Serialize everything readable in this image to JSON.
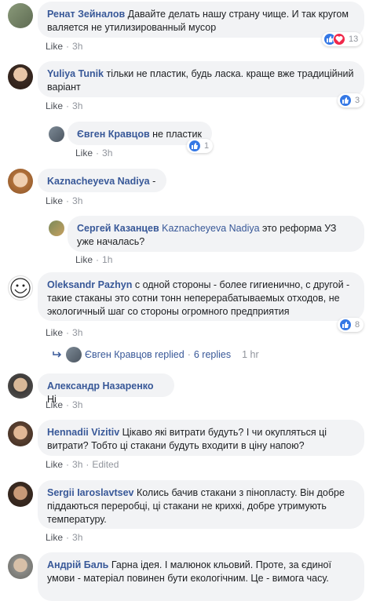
{
  "comments": [
    {
      "name": "Ренат Зейналов",
      "text": "Давайте делать нашу страну чище. И так кругом валяется не утилизированный мусор",
      "meta_like": "Like",
      "meta_time": "3h",
      "reactions": "13"
    },
    {
      "name": "Yuliya Tunik",
      "text": "тільки не пластик, будь ласка. краще вже традиційний варіант",
      "meta_like": "Like",
      "meta_time": "3h",
      "reactions": "3"
    },
    {
      "name": "Євген Кравцов",
      "text": "не пластик",
      "meta_like": "Like",
      "meta_time": "3h",
      "reactions": "1"
    },
    {
      "name": "Kaznacheyeva Nadiya",
      "text": "-",
      "meta_like": "Like",
      "meta_time": "3h"
    },
    {
      "name": "Сергей Казанцев",
      "mention": "Kaznacheyeva Nadiya",
      "text": "это реформа УЗ уже началась?",
      "meta_like": "Like",
      "meta_time": "1h"
    },
    {
      "name": "Oleksandr Pazhyn",
      "text": "с одной стороны - более гигиенично, с другой - такие стаканы это сотни тонн неперерабатываемых отходов, не экологичный шаг со стороны огромного предприятия",
      "meta_like": "Like",
      "meta_time": "3h",
      "reactions": "8"
    },
    {
      "name": "Александр Назаренко",
      "text": "Ні",
      "meta_like": "Like",
      "meta_time": "3h"
    },
    {
      "name": "Hennadii Vizitiv",
      "text": "Цікаво які витрати будуть? І чи окупляться ці витрати? Тобто ці стакани будуть входити в ціну напою?",
      "meta_like": "Like",
      "meta_time": "3h",
      "meta_edited": "Edited"
    },
    {
      "name": "Sergii Iaroslavtsev",
      "text": "Колись бачив стакани з пінопласту. Він добре піддаються переробці, ці стакани не крихкі, добре утримують температуру.",
      "meta_like": "Like",
      "meta_time": "3h"
    },
    {
      "name": "Андрій Баль",
      "text": "Гарна ідея. І малюнок кльовий. Проте, за єдиної умови - матеріал повинен бути екологічним. Це - вимога часу."
    }
  ],
  "replies_link": {
    "name": "Євген Кравцов",
    "action": "replied",
    "count": "6 replies",
    "time": "1 hr"
  },
  "colors": {
    "link": "#385898",
    "bubble": "#f2f3f5",
    "like": "#3578e5",
    "love": "#f0284a",
    "meta": "#90949c"
  }
}
